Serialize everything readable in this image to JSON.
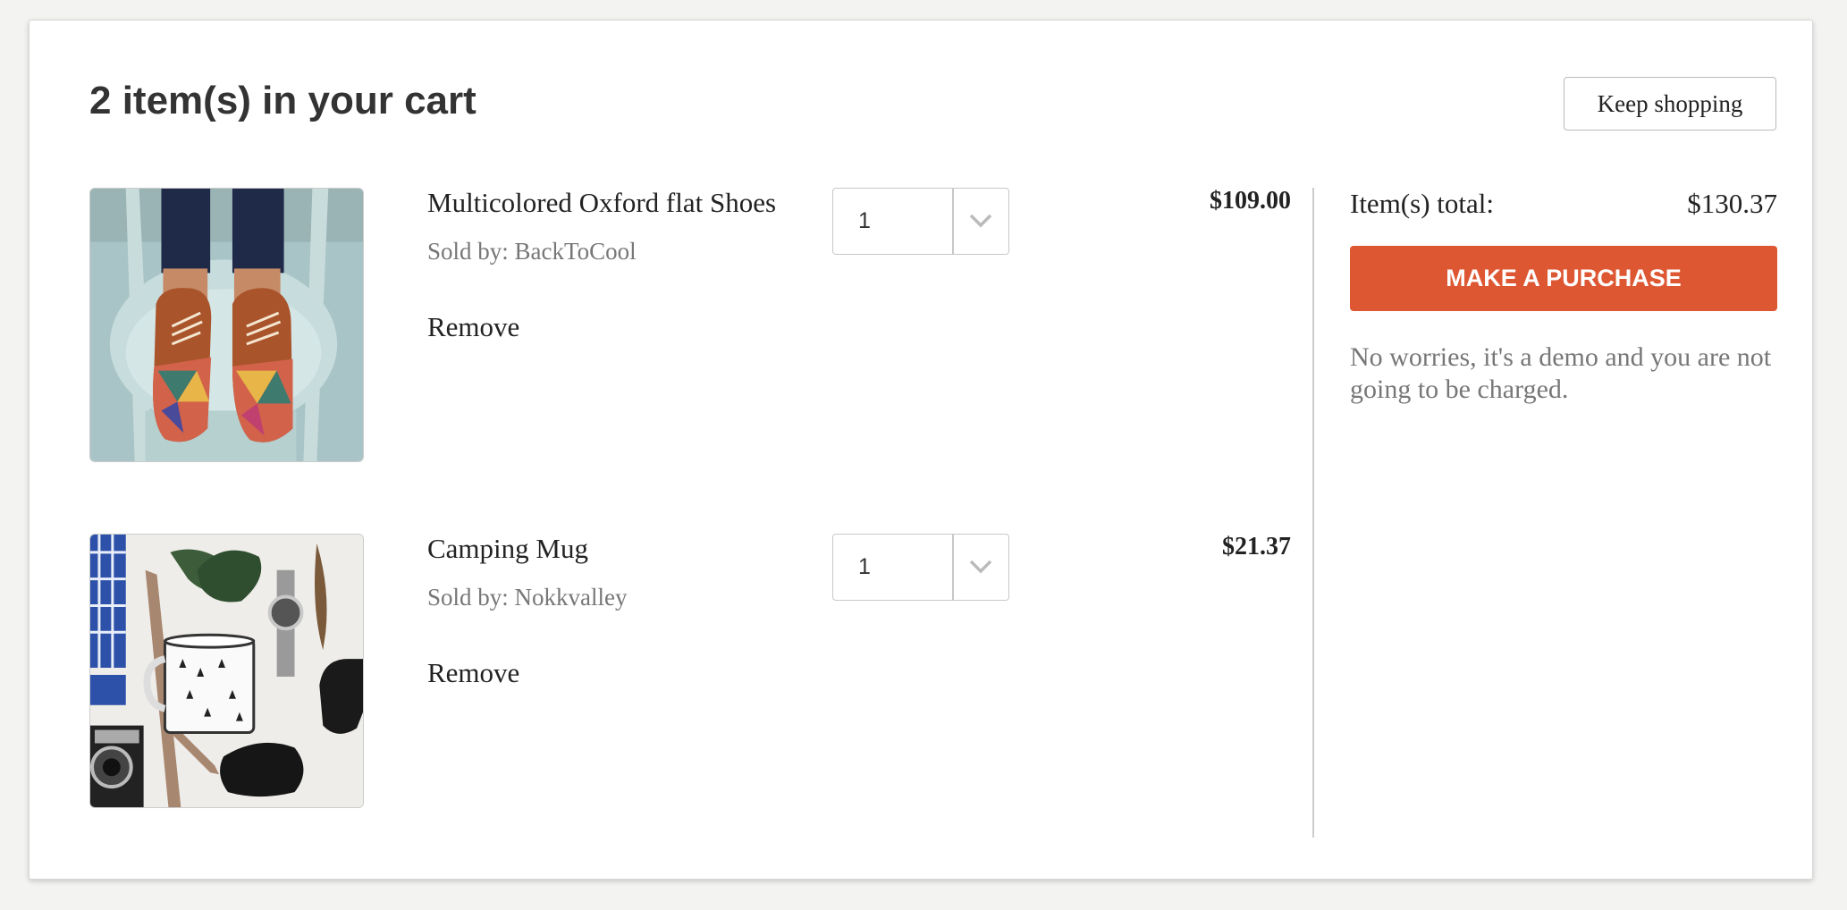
{
  "cart": {
    "title": "2 item(s) in your cart",
    "keep_shopping_label": "Keep shopping",
    "items": [
      {
        "name": "Multicolored Oxford flat Shoes",
        "seller": "Sold by: BackToCool",
        "quantity": "1",
        "price": "$109.00",
        "remove_label": "Remove",
        "image_icon": "shoes-photo"
      },
      {
        "name": "Camping Mug",
        "seller": "Sold by: Nokkvalley",
        "quantity": "1",
        "price": "$21.37",
        "remove_label": "Remove",
        "image_icon": "mug-photo"
      }
    ]
  },
  "summary": {
    "total_label": "Item(s) total:",
    "total_value": "$130.37",
    "purchase_label": "MAKE A PURCHASE",
    "note": "No worries, it's a demo and you are not going to be charged."
  },
  "colors": {
    "accent": "#de5733",
    "background": "#f3f3f1",
    "card": "#ffffff"
  }
}
